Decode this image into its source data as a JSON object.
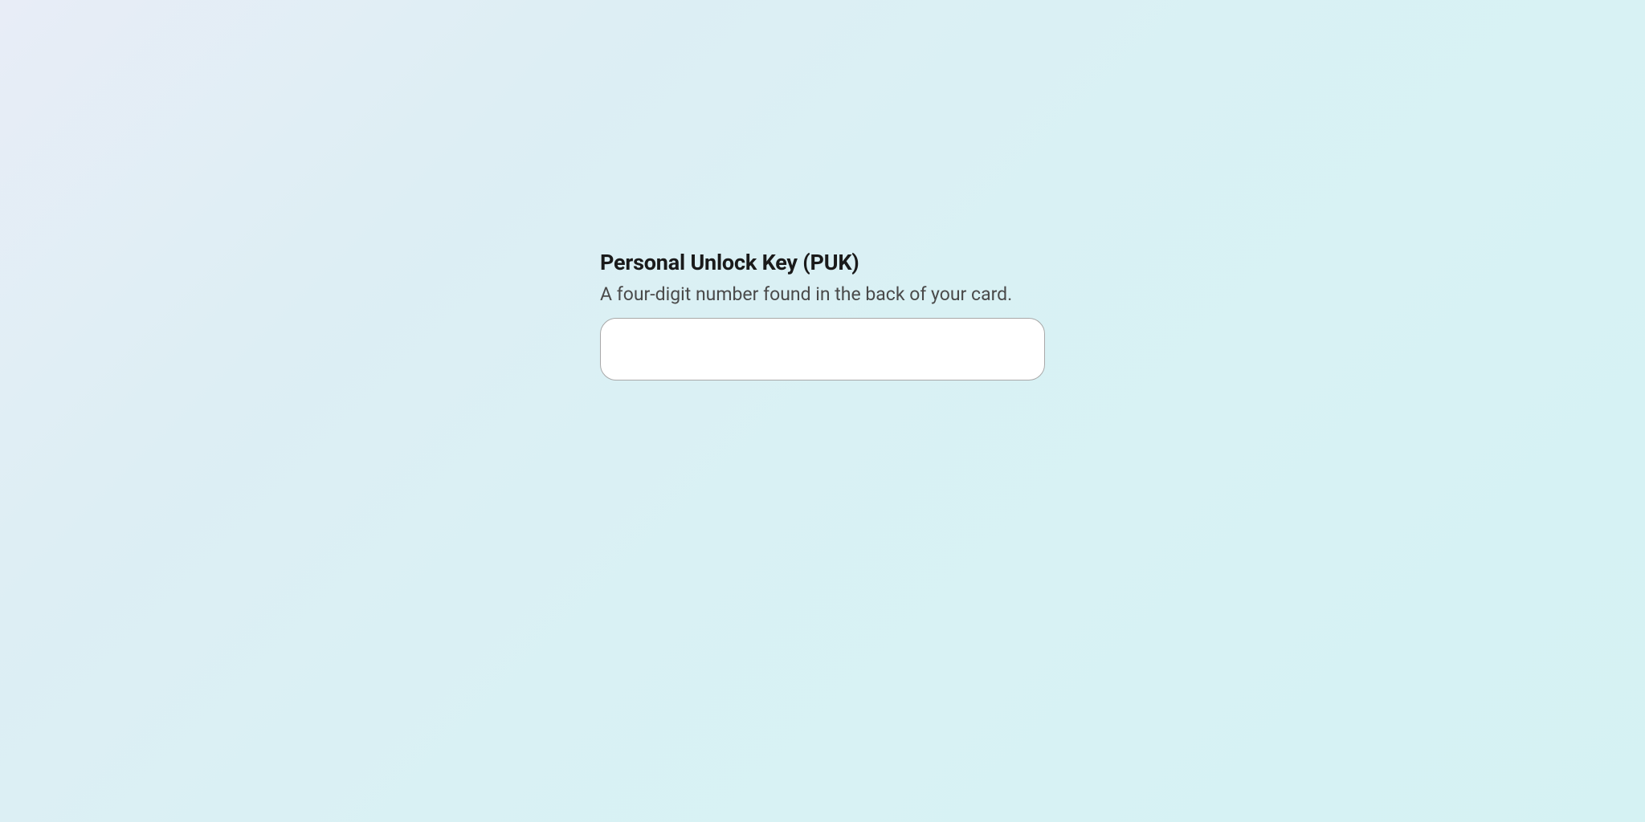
{
  "form": {
    "title": "Personal Unlock Key (PUK)",
    "description": "A four-digit number found in the back of your card.",
    "input_value": "",
    "input_placeholder": ""
  }
}
